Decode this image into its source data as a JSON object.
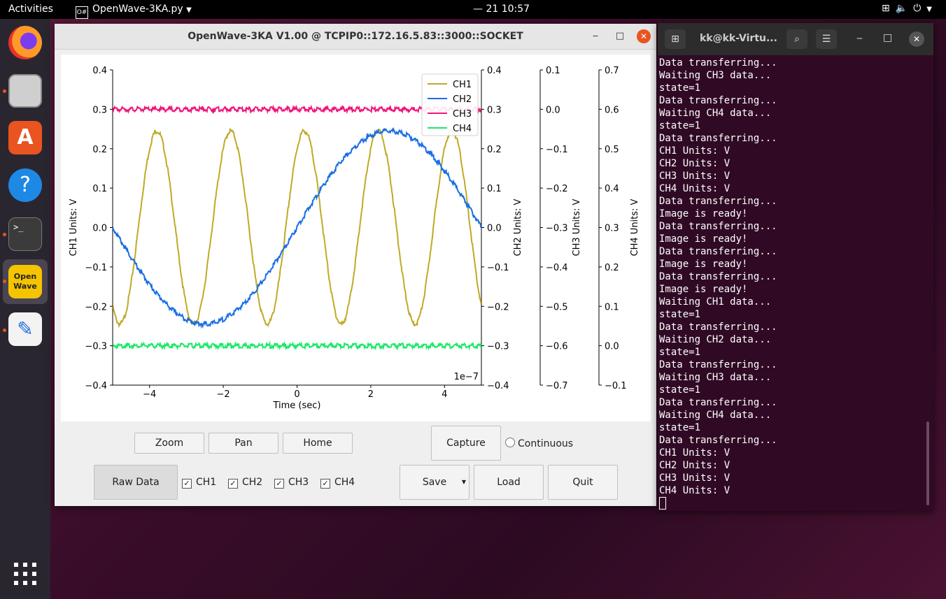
{
  "topbar": {
    "activities": "Activities",
    "app_name": "OpenWave-3KA.py",
    "app_icon_text": "O#",
    "clock": "— 21  10:57",
    "tray_icons": [
      "network-icon",
      "volume-icon",
      "power-icon",
      "chevron-down-icon"
    ]
  },
  "dock": {
    "items": [
      "firefox-icon",
      "files-icon",
      "software-center-icon",
      "help-icon",
      "terminal-icon",
      "openwave-icon",
      "text-editor-icon"
    ],
    "apps_grid_icon": "apps-grid-icon",
    "openwave_label": "Open Wave"
  },
  "window": {
    "title": "OpenWave-3KA V1.00 @ TCPIP0::172.16.5.83::3000::SOCKET",
    "buttons": {
      "zoom": "Zoom",
      "pan": "Pan",
      "home": "Home",
      "capture": "Capture",
      "continuous": "Continuous",
      "raw_data": "Raw Data",
      "save": "Save",
      "load": "Load",
      "quit": "Quit"
    },
    "checkboxes": [
      {
        "label": "CH1",
        "checked": true
      },
      {
        "label": "CH2",
        "checked": true
      },
      {
        "label": "CH3",
        "checked": true
      },
      {
        "label": "CH4",
        "checked": true
      }
    ]
  },
  "chart_data": {
    "type": "line",
    "xlabel": "Time (sec)",
    "x_offset_label": "1e−7",
    "xlim": [
      -5,
      5
    ],
    "xticks": [
      "−4",
      "−2",
      "0",
      "2",
      "4"
    ],
    "xtick_values": [
      -4,
      -2,
      0,
      2,
      4
    ],
    "axes": [
      {
        "label": "CH1 Units: V",
        "lim": [
          -0.4,
          0.4
        ],
        "ticks": [
          "0.4",
          "0.3",
          "0.2",
          "0.1",
          "0.0",
          "−0.1",
          "−0.2",
          "−0.3",
          "−0.4"
        ]
      },
      {
        "label": "CH2 Units: V",
        "lim": [
          -0.4,
          0.4
        ],
        "ticks": [
          "0.4",
          "0.3",
          "0.2",
          "0.1",
          "0.0",
          "−0.1",
          "−0.2",
          "−0.3",
          "−0.4"
        ]
      },
      {
        "label": "CH3 Units: V",
        "lim": [
          -0.7,
          0.1
        ],
        "ticks": [
          "0.1",
          "0.0",
          "−0.1",
          "−0.2",
          "−0.3",
          "−0.4",
          "−0.5",
          "−0.6",
          "−0.7"
        ]
      },
      {
        "label": "CH4 Units: V",
        "lim": [
          -0.1,
          0.7
        ],
        "ticks": [
          "0.7",
          "0.6",
          "0.5",
          "0.4",
          "0.3",
          "0.2",
          "0.1",
          "0.0",
          "−0.1"
        ]
      }
    ],
    "series": [
      {
        "name": "CH1",
        "color": "#bfaa27",
        "shape": "sine",
        "amplitude": 0.245,
        "frequency_per_unit": 0.5,
        "phase_at_zero": 0.95,
        "axis": 0
      },
      {
        "name": "CH2",
        "color": "#1a6ee6",
        "shape": "sine",
        "amplitude": 0.245,
        "frequency_per_unit": 0.1,
        "phase_at_zero": 0.0,
        "axis": 1
      },
      {
        "name": "CH3",
        "color": "#f0157a",
        "shape": "flat",
        "value": 0.0,
        "axis": 2
      },
      {
        "name": "CH4",
        "color": "#1ee86a",
        "shape": "flat",
        "value": 0.0,
        "axis": 3
      }
    ],
    "legend": [
      "CH1",
      "CH2",
      "CH3",
      "CH4"
    ],
    "legend_placement": "top-right",
    "grid": false
  },
  "terminal": {
    "title": "kk@kk-Virtu...",
    "lines": [
      "Data transferring...",
      "Waiting CH3 data...",
      "state=1",
      "Data transferring...",
      "Waiting CH4 data...",
      "state=1",
      "Data transferring...",
      "CH1 Units: V",
      "CH2 Units: V",
      "CH3 Units: V",
      "CH4 Units: V",
      "Data transferring...",
      "Image is ready!",
      "Data transferring...",
      "Image is ready!",
      "Data transferring...",
      "Image is ready!",
      "Data transferring...",
      "Image is ready!",
      "Waiting CH1 data...",
      "state=1",
      "Data transferring...",
      "Waiting CH2 data...",
      "state=1",
      "Data transferring...",
      "Waiting CH3 data...",
      "state=1",
      "Data transferring...",
      "Waiting CH4 data...",
      "state=1",
      "Data transferring...",
      "CH1 Units: V",
      "CH2 Units: V",
      "CH3 Units: V",
      "CH4 Units: V"
    ]
  }
}
